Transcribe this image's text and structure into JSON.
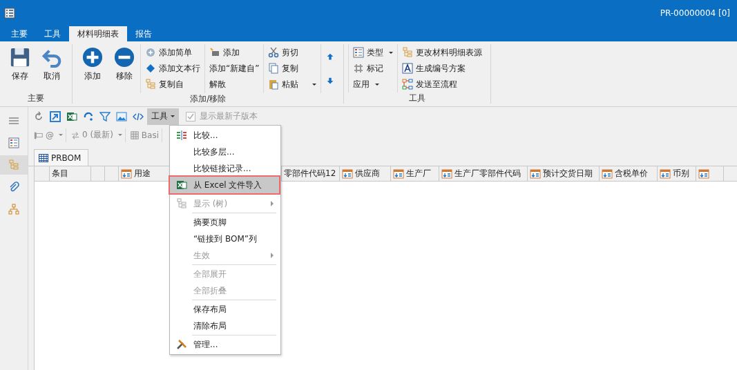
{
  "title_bar": {
    "record": "PR-00000004 [0]"
  },
  "ribbon_tabs": [
    {
      "label": "主要",
      "selected": false
    },
    {
      "label": "工具",
      "selected": false
    },
    {
      "label": "材料明细表",
      "selected": true
    },
    {
      "label": "报告",
      "selected": false
    }
  ],
  "ribbon_groups": [
    {
      "label": "主要",
      "columns": [
        {
          "kind": "large",
          "items": [
            {
              "label": "保存"
            }
          ]
        },
        {
          "kind": "large",
          "items": [
            {
              "label": "取消"
            }
          ]
        }
      ]
    },
    {
      "label": "添加/移除",
      "columns": [
        {
          "kind": "large",
          "items": [
            {
              "label": "添加"
            }
          ]
        },
        {
          "kind": "large",
          "items": [
            {
              "label": "移除"
            }
          ]
        },
        {
          "kind": "small",
          "items": [
            {
              "label": "添加简单"
            },
            {
              "label": "添加文本行"
            },
            {
              "label": "复制自"
            }
          ]
        },
        {
          "kind": "small",
          "items": [
            {
              "label": "添加"
            },
            {
              "label": "添加“新建自”"
            },
            {
              "label": "解散"
            }
          ]
        },
        {
          "kind": "small",
          "items": [
            {
              "label": "剪切",
              "dropdown": false
            },
            {
              "label": "复制",
              "dropdown": false
            },
            {
              "label": "粘贴",
              "dropdown": true
            }
          ]
        },
        {
          "kind": "arrows"
        }
      ]
    },
    {
      "label": "工具",
      "columns": [
        {
          "kind": "small",
          "items": [
            {
              "label": "类型",
              "dropdown": true
            },
            {
              "label": "标记",
              "dropdown": false
            },
            {
              "label": "应用",
              "dropdown": true
            }
          ]
        },
        {
          "kind": "small",
          "items": [
            {
              "label": "更改材料明细表源"
            },
            {
              "label": "生成编号方案"
            },
            {
              "label": "发送至流程"
            }
          ]
        }
      ]
    }
  ],
  "sidebar": [
    {
      "selected": false
    },
    {
      "selected": false
    },
    {
      "selected": true
    },
    {
      "selected": false
    },
    {
      "selected": false
    }
  ],
  "toolbar": {
    "tools_button": {
      "label": "工具",
      "open": true
    },
    "show_latest": {
      "label": "显示最新子版本",
      "checked": true,
      "disabled": true
    }
  },
  "toolbar2": [
    {
      "label": "@",
      "dropdown": true
    },
    {
      "label": "0 (最新)",
      "dropdown": true
    },
    {
      "label": "Basi",
      "dropdown": false
    }
  ],
  "doc_tab": {
    "label": "PRBOM"
  },
  "table": {
    "columns": [
      {
        "icon": false
      },
      {
        "label": "条目",
        "icon": false
      },
      {
        "icon": false
      },
      {
        "icon": false
      },
      {
        "label": "用途",
        "icon": true
      },
      {
        "label": "零部件代码12",
        "icon": false
      },
      {
        "label": "供应商",
        "icon": true
      },
      {
        "label": "生产厂",
        "icon": true
      },
      {
        "label": "生产厂零部件代码",
        "icon": true
      },
      {
        "label": "预计交货日期",
        "icon": true
      },
      {
        "label": "含税单价",
        "icon": true
      },
      {
        "label": "币别",
        "icon": true
      },
      {
        "icon": true
      }
    ]
  },
  "menu": {
    "sections": [
      [
        {
          "label": "比较...",
          "disabled": false,
          "selected": false,
          "submenu": false
        },
        {
          "label": "比较多层...",
          "disabled": false,
          "selected": false,
          "submenu": false
        },
        {
          "label": "比较链接记录...",
          "disabled": false,
          "selected": false,
          "submenu": false
        },
        {
          "label": "从 Excel 文件导入",
          "disabled": false,
          "selected": true,
          "submenu": false
        }
      ],
      [
        {
          "label": "显示 (树)",
          "disabled": true,
          "selected": false,
          "submenu": true
        }
      ],
      [
        {
          "label": "摘要页脚",
          "disabled": false,
          "selected": false,
          "submenu": false
        },
        {
          "label": "“链接到 BOM”列",
          "disabled": false,
          "selected": false,
          "submenu": false
        },
        {
          "label": "生效",
          "disabled": true,
          "selected": false,
          "submenu": true
        }
      ],
      [
        {
          "label": "全部展开",
          "disabled": true,
          "selected": false,
          "submenu": false
        },
        {
          "label": "全部折叠",
          "disabled": true,
          "selected": false,
          "submenu": false
        }
      ],
      [
        {
          "label": "保存布局",
          "disabled": false,
          "selected": false,
          "submenu": false
        },
        {
          "label": "清除布局",
          "disabled": false,
          "selected": false,
          "submenu": false
        }
      ],
      [
        {
          "label": "管理...",
          "disabled": false,
          "selected": false,
          "submenu": false
        }
      ]
    ]
  }
}
